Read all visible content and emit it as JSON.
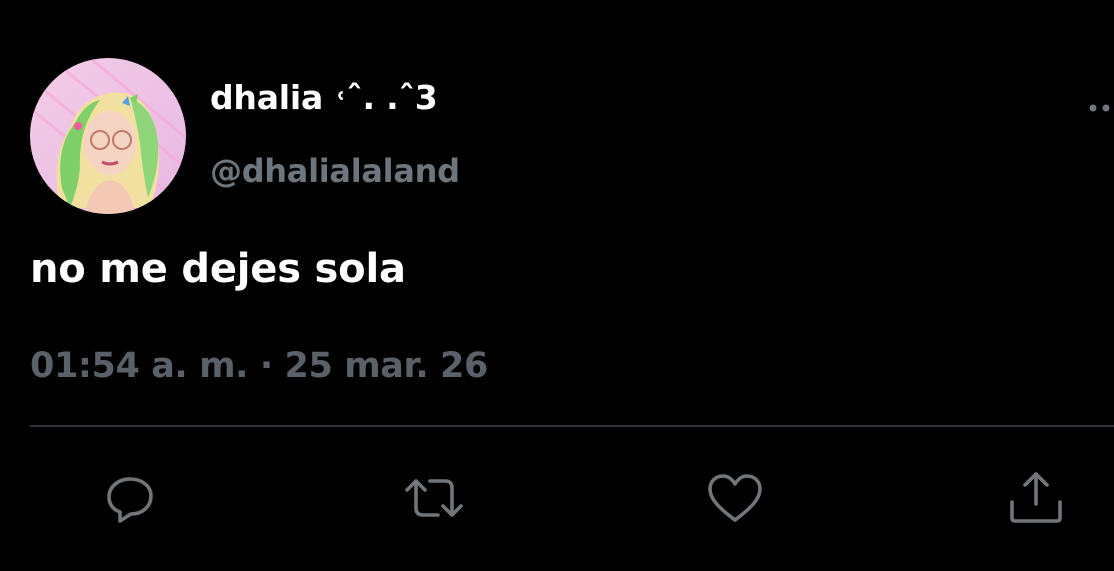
{
  "user": {
    "display_name": "dhalia ˓ˆ. .ˆ3",
    "handle": "@dhalialaland"
  },
  "tweet": {
    "text": "no me dejes sola",
    "timestamp": "01:54 a. m. · 25 mar. 26"
  },
  "icons": {
    "more": "more-dots-icon",
    "reply": "reply-icon",
    "retweet": "retweet-icon",
    "like": "like-icon",
    "share": "share-icon"
  },
  "colors": {
    "background": "#000000",
    "primary_text": "#ffffff",
    "secondary_text": "#6e767d",
    "icon": "#71767b",
    "divider": "#2f3336"
  }
}
